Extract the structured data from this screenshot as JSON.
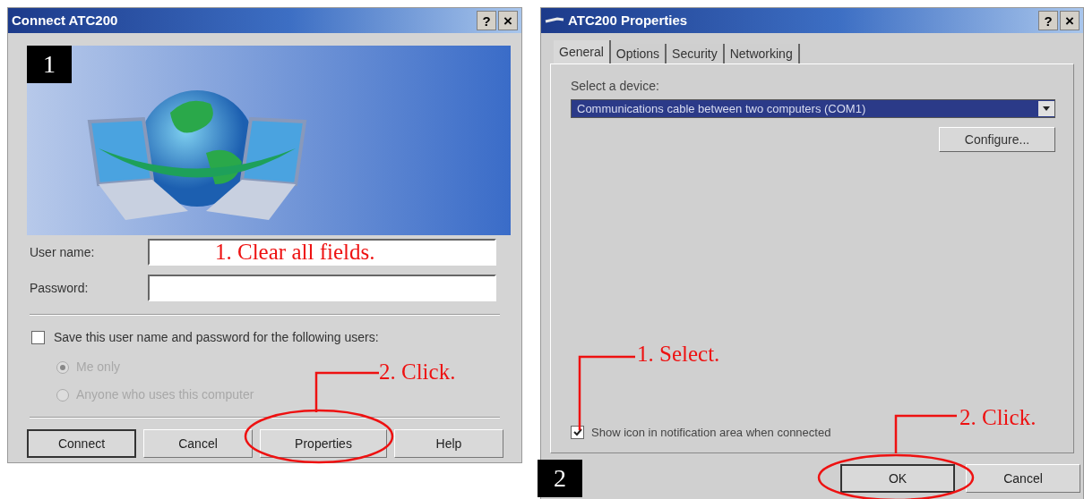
{
  "connect_dialog": {
    "title": "Connect ATC200",
    "help_glyph": "?",
    "close_glyph": "×",
    "step_badge": "1",
    "fields": [
      {
        "label": "User name:"
      },
      {
        "label": "Password:"
      }
    ],
    "save_checkbox": {
      "label": "Save this user name and password for the following users:",
      "checked": false
    },
    "radios": [
      {
        "label": "Me only",
        "selected": true,
        "disabled": true
      },
      {
        "label": "Anyone who uses this computer",
        "selected": false,
        "disabled": true
      }
    ],
    "buttons": [
      {
        "label": "Connect",
        "default": true
      },
      {
        "label": "Cancel",
        "default": false
      },
      {
        "label": "Properties",
        "default": false
      },
      {
        "label": "Help",
        "default": false
      }
    ],
    "annotations": [
      {
        "text": "1. Clear all fields."
      },
      {
        "text": "2. Click."
      }
    ]
  },
  "properties_dialog": {
    "title": "ATC200 Properties",
    "help_glyph": "?",
    "close_glyph": "×",
    "step_badge": "2",
    "tabs": [
      {
        "label": "General",
        "selected": true
      },
      {
        "label": "Options",
        "selected": false
      },
      {
        "label": "Security",
        "selected": false
      },
      {
        "label": "Networking",
        "selected": false
      }
    ],
    "device_label": "Select a device:",
    "device_value": "Communications cable between two computers (COM1)",
    "configure_button": "Configure...",
    "show_icon_checkbox": {
      "label": "Show icon in notification area when connected",
      "checked": true
    },
    "buttons": [
      {
        "label": "OK",
        "default": true
      },
      {
        "label": "Cancel",
        "default": false
      }
    ],
    "annotations": [
      {
        "text": "1. Select."
      },
      {
        "text": "2. Click."
      }
    ]
  }
}
